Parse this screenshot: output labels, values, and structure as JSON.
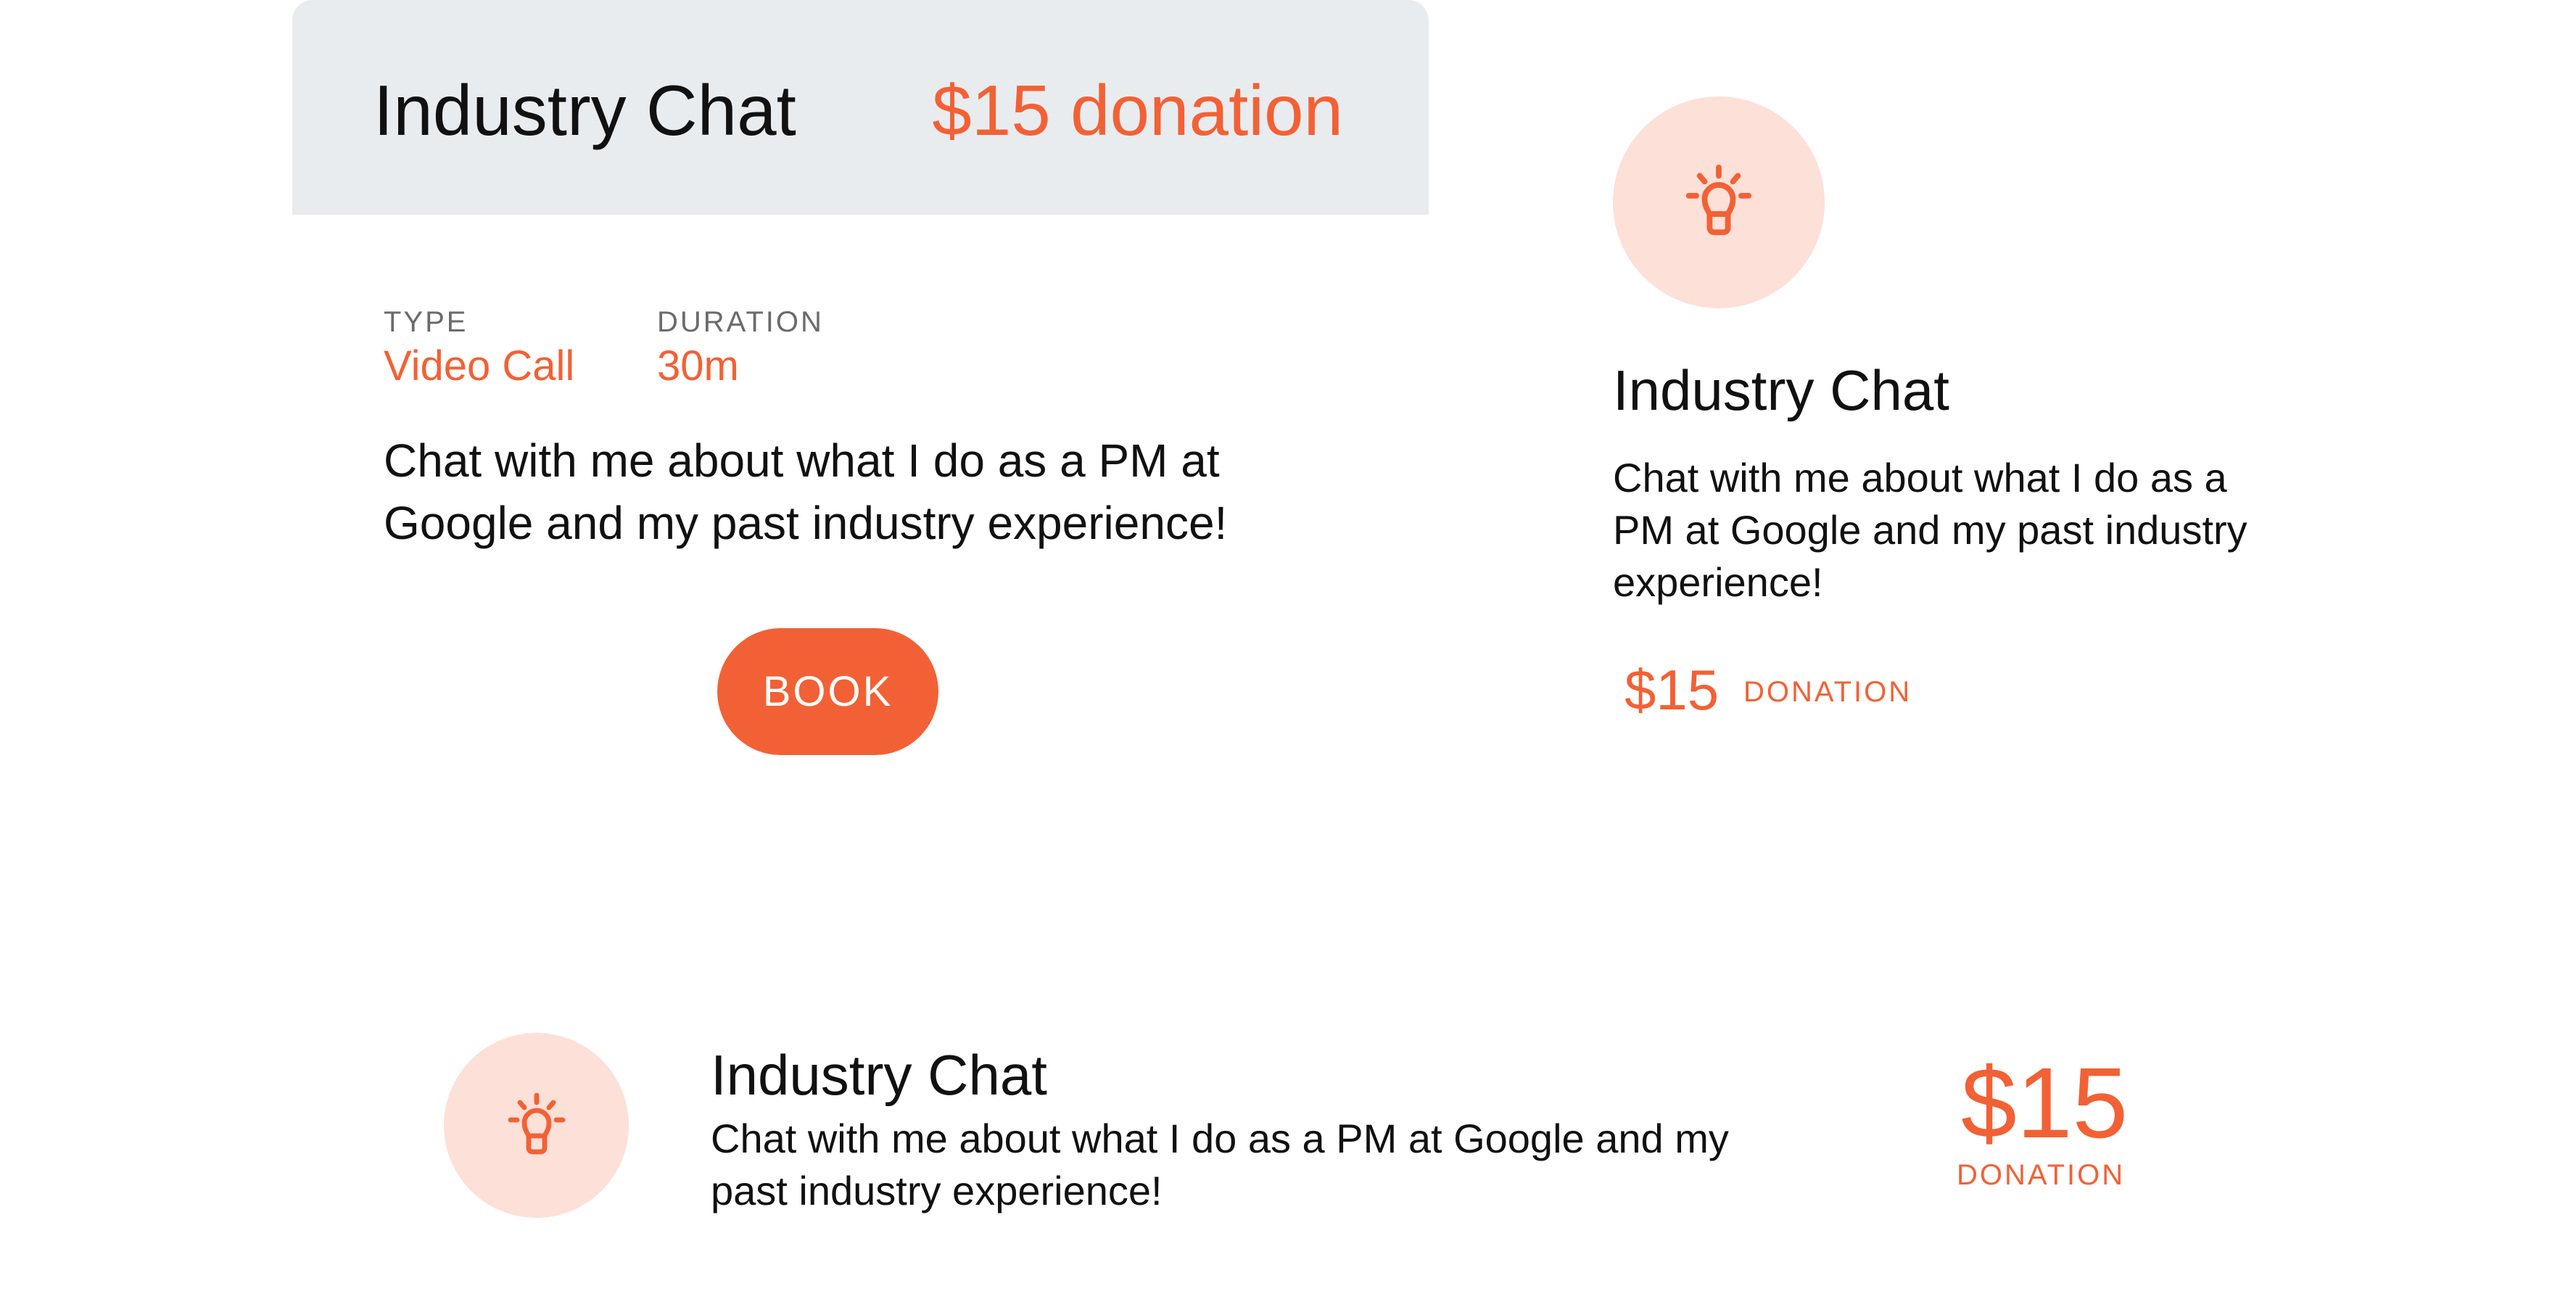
{
  "colors": {
    "accent": "#f26135",
    "icon_bg": "#fde0d8",
    "header_bg": "#e9ecef",
    "text": "#111111",
    "muted": "#6b6b6b"
  },
  "card1": {
    "title": "Industry Chat",
    "price": "$15 donation",
    "type_label": "TYPE",
    "type_value": "Video Call",
    "duration_label": "DURATION",
    "duration_value": "30m",
    "description": "Chat with me about what I do as a PM at Google and my past industry experience!",
    "button_label": "BOOK"
  },
  "card2": {
    "icon": "lightbulb-icon",
    "title": "Industry Chat",
    "description": "Chat with me about what I do as a PM at Google and my past industry experience!",
    "price": "$15",
    "price_label": "DONATION"
  },
  "card3": {
    "icon": "lightbulb-icon",
    "title": "Industry Chat",
    "description": "Chat with me about what I do as a PM at Google and my past industry experience!",
    "price": "$15",
    "price_label": "DONATION"
  }
}
